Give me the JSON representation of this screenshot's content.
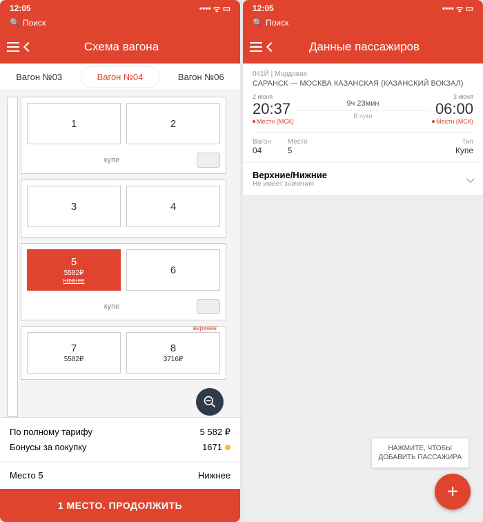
{
  "status": {
    "time": "12:05",
    "signal": "▪▪▪▪",
    "wifi": "wifi",
    "battery": "▮"
  },
  "search_label": "Поиск",
  "left": {
    "header_title": "Схема вагона",
    "tabs": [
      "Вагон №03",
      "Вагон №04",
      "Вагон №06"
    ],
    "active_tab": 1,
    "compartments": [
      {
        "seats": [
          {
            "num": "1"
          },
          {
            "num": "2"
          }
        ],
        "label": "купе"
      },
      {
        "seats": [
          {
            "num": "3"
          },
          {
            "num": "4"
          }
        ],
        "label": ""
      },
      {
        "seats": [
          {
            "num": "5",
            "price": "5582₽",
            "berth": "нижнее",
            "selected": true
          },
          {
            "num": "6"
          }
        ],
        "label": "купе"
      },
      {
        "seats": [
          {
            "num": "7",
            "price": "5582₽"
          },
          {
            "num": "8",
            "price": "3716₽",
            "top_tag": "верхнее"
          }
        ],
        "label": ""
      }
    ],
    "summary": {
      "full_fare_label": "По полному тарифу",
      "full_fare_value": "5 582 ₽",
      "bonus_label": "Бонусы за покупку",
      "bonus_value": "1671"
    },
    "seat_summary": {
      "seat": "Место 5",
      "berth": "Нижнее"
    },
    "continue": "1 МЕСТО. ПРОДОЛЖИТЬ"
  },
  "right": {
    "header_title": "Данные пассажиров",
    "train": "041Й | Мордовия",
    "route": "САРАНСК — МОСКВА КАЗАНСКАЯ (КАЗАНСКИЙ ВОКЗАЛ)",
    "dep": {
      "date": "2 июня",
      "time": "20:37",
      "tz": "Местн (МСК)"
    },
    "arr": {
      "date": "3 июня",
      "time": "06:00",
      "tz": "Местн (МСК)"
    },
    "duration": {
      "main": "9ч 23мин",
      "sub": "В пути"
    },
    "meta": {
      "wagon_label": "Вагон",
      "wagon_val": "04",
      "seat_label": "Место",
      "seat_val": "5",
      "type_label": "Тип",
      "type_val": "Купе"
    },
    "pref": {
      "title": "Верхние/Нижние",
      "sub": "Не имеет значения"
    },
    "tooltip": "НАЖМИТЕ, ЧТОБЫ\nДОБАВИТЬ ПАССАЖИРА"
  }
}
